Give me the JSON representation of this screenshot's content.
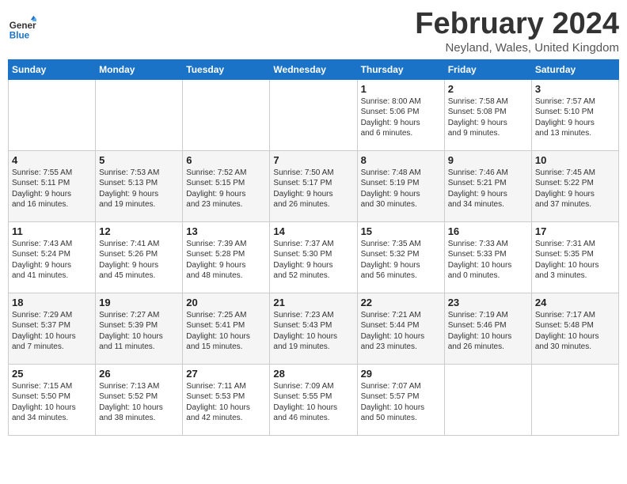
{
  "header": {
    "logo_line1": "General",
    "logo_line2": "Blue",
    "title": "February 2024",
    "subtitle": "Neyland, Wales, United Kingdom"
  },
  "days_of_week": [
    "Sunday",
    "Monday",
    "Tuesday",
    "Wednesday",
    "Thursday",
    "Friday",
    "Saturday"
  ],
  "weeks": [
    [
      {
        "day": "",
        "info": ""
      },
      {
        "day": "",
        "info": ""
      },
      {
        "day": "",
        "info": ""
      },
      {
        "day": "",
        "info": ""
      },
      {
        "day": "1",
        "info": "Sunrise: 8:00 AM\nSunset: 5:06 PM\nDaylight: 9 hours\nand 6 minutes."
      },
      {
        "day": "2",
        "info": "Sunrise: 7:58 AM\nSunset: 5:08 PM\nDaylight: 9 hours\nand 9 minutes."
      },
      {
        "day": "3",
        "info": "Sunrise: 7:57 AM\nSunset: 5:10 PM\nDaylight: 9 hours\nand 13 minutes."
      }
    ],
    [
      {
        "day": "4",
        "info": "Sunrise: 7:55 AM\nSunset: 5:11 PM\nDaylight: 9 hours\nand 16 minutes."
      },
      {
        "day": "5",
        "info": "Sunrise: 7:53 AM\nSunset: 5:13 PM\nDaylight: 9 hours\nand 19 minutes."
      },
      {
        "day": "6",
        "info": "Sunrise: 7:52 AM\nSunset: 5:15 PM\nDaylight: 9 hours\nand 23 minutes."
      },
      {
        "day": "7",
        "info": "Sunrise: 7:50 AM\nSunset: 5:17 PM\nDaylight: 9 hours\nand 26 minutes."
      },
      {
        "day": "8",
        "info": "Sunrise: 7:48 AM\nSunset: 5:19 PM\nDaylight: 9 hours\nand 30 minutes."
      },
      {
        "day": "9",
        "info": "Sunrise: 7:46 AM\nSunset: 5:21 PM\nDaylight: 9 hours\nand 34 minutes."
      },
      {
        "day": "10",
        "info": "Sunrise: 7:45 AM\nSunset: 5:22 PM\nDaylight: 9 hours\nand 37 minutes."
      }
    ],
    [
      {
        "day": "11",
        "info": "Sunrise: 7:43 AM\nSunset: 5:24 PM\nDaylight: 9 hours\nand 41 minutes."
      },
      {
        "day": "12",
        "info": "Sunrise: 7:41 AM\nSunset: 5:26 PM\nDaylight: 9 hours\nand 45 minutes."
      },
      {
        "day": "13",
        "info": "Sunrise: 7:39 AM\nSunset: 5:28 PM\nDaylight: 9 hours\nand 48 minutes."
      },
      {
        "day": "14",
        "info": "Sunrise: 7:37 AM\nSunset: 5:30 PM\nDaylight: 9 hours\nand 52 minutes."
      },
      {
        "day": "15",
        "info": "Sunrise: 7:35 AM\nSunset: 5:32 PM\nDaylight: 9 hours\nand 56 minutes."
      },
      {
        "day": "16",
        "info": "Sunrise: 7:33 AM\nSunset: 5:33 PM\nDaylight: 10 hours\nand 0 minutes."
      },
      {
        "day": "17",
        "info": "Sunrise: 7:31 AM\nSunset: 5:35 PM\nDaylight: 10 hours\nand 3 minutes."
      }
    ],
    [
      {
        "day": "18",
        "info": "Sunrise: 7:29 AM\nSunset: 5:37 PM\nDaylight: 10 hours\nand 7 minutes."
      },
      {
        "day": "19",
        "info": "Sunrise: 7:27 AM\nSunset: 5:39 PM\nDaylight: 10 hours\nand 11 minutes."
      },
      {
        "day": "20",
        "info": "Sunrise: 7:25 AM\nSunset: 5:41 PM\nDaylight: 10 hours\nand 15 minutes."
      },
      {
        "day": "21",
        "info": "Sunrise: 7:23 AM\nSunset: 5:43 PM\nDaylight: 10 hours\nand 19 minutes."
      },
      {
        "day": "22",
        "info": "Sunrise: 7:21 AM\nSunset: 5:44 PM\nDaylight: 10 hours\nand 23 minutes."
      },
      {
        "day": "23",
        "info": "Sunrise: 7:19 AM\nSunset: 5:46 PM\nDaylight: 10 hours\nand 26 minutes."
      },
      {
        "day": "24",
        "info": "Sunrise: 7:17 AM\nSunset: 5:48 PM\nDaylight: 10 hours\nand 30 minutes."
      }
    ],
    [
      {
        "day": "25",
        "info": "Sunrise: 7:15 AM\nSunset: 5:50 PM\nDaylight: 10 hours\nand 34 minutes."
      },
      {
        "day": "26",
        "info": "Sunrise: 7:13 AM\nSunset: 5:52 PM\nDaylight: 10 hours\nand 38 minutes."
      },
      {
        "day": "27",
        "info": "Sunrise: 7:11 AM\nSunset: 5:53 PM\nDaylight: 10 hours\nand 42 minutes."
      },
      {
        "day": "28",
        "info": "Sunrise: 7:09 AM\nSunset: 5:55 PM\nDaylight: 10 hours\nand 46 minutes."
      },
      {
        "day": "29",
        "info": "Sunrise: 7:07 AM\nSunset: 5:57 PM\nDaylight: 10 hours\nand 50 minutes."
      },
      {
        "day": "",
        "info": ""
      },
      {
        "day": "",
        "info": ""
      }
    ]
  ]
}
